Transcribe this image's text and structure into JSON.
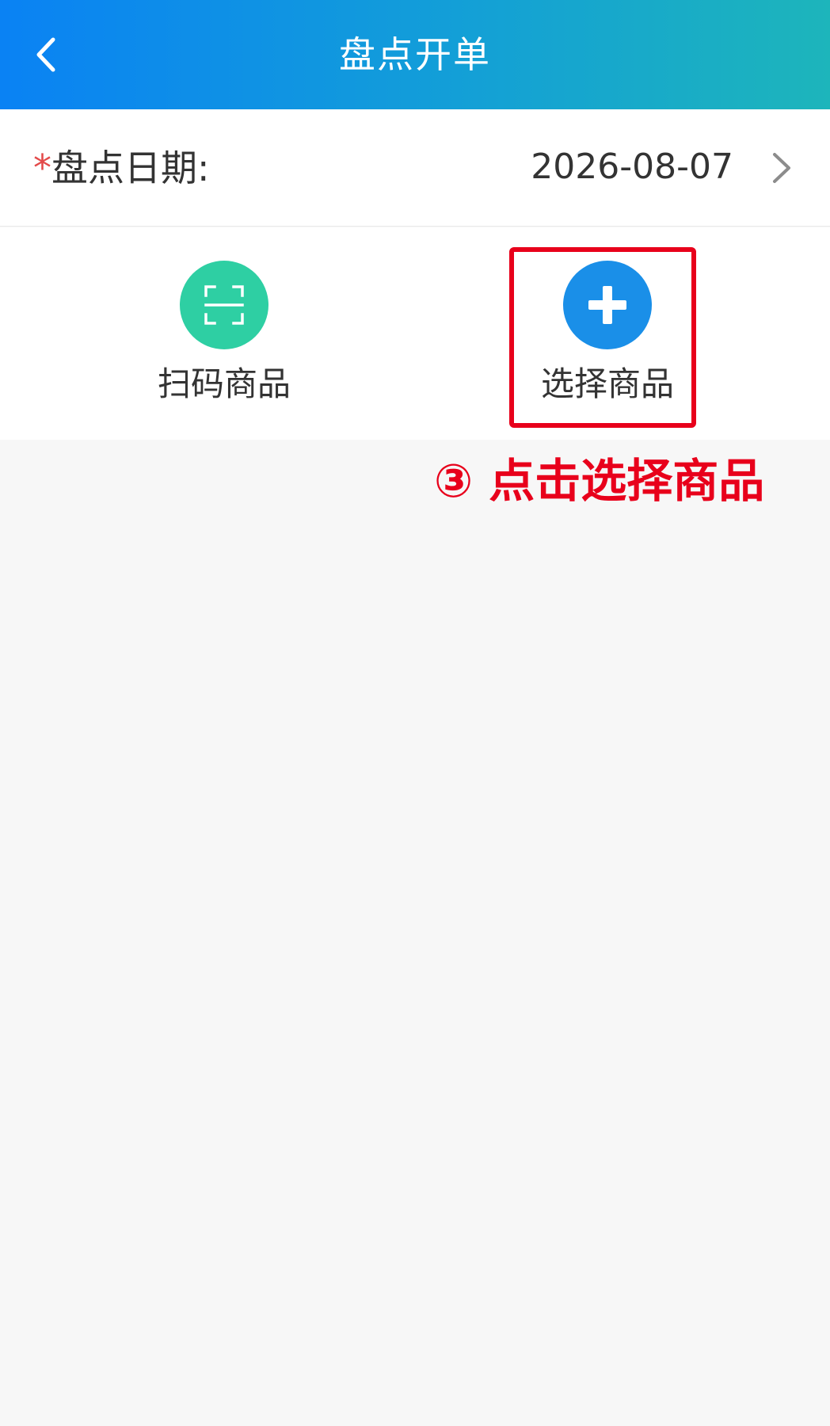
{
  "header": {
    "title": "盘点开单",
    "back_icon": "chevron-left-icon"
  },
  "date_row": {
    "required_mark": "*",
    "label": "盘点日期:",
    "value": "2026-08-07",
    "arrow_icon": "chevron-right-icon"
  },
  "actions": [
    {
      "label": "扫码商品",
      "icon": "scan-icon",
      "color": "#2ecfa3"
    },
    {
      "label": "选择商品",
      "icon": "plus-icon",
      "color": "#1a8fe8"
    }
  ],
  "annotation": {
    "text": "③ 点击选择商品",
    "color": "#e8001b"
  },
  "colors": {
    "header_gradient_start": "#0a82f4",
    "header_gradient_end": "#1db5bb",
    "background": "#f7f7f7"
  }
}
